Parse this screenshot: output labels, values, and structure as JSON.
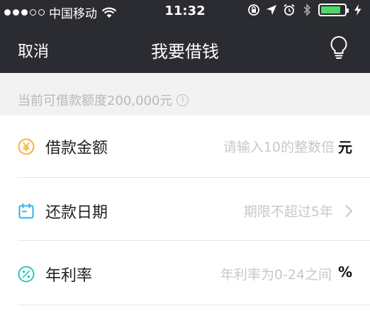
{
  "status_bar": {
    "carrier": "中国移动",
    "time": "11:32",
    "battery_level": 0.85
  },
  "nav": {
    "cancel_label": "取消",
    "title": "我要借钱",
    "right_icon": "lightbulb-icon"
  },
  "quota": {
    "text": "当前可借款额度200,000元",
    "icon": "info-icon",
    "icon_glyph": "i"
  },
  "form": {
    "rows": [
      {
        "icon": "yuan-coin-icon",
        "label": "借款金额",
        "placeholder": "请输入10的整数倍",
        "unit": "元"
      },
      {
        "icon": "calendar-icon",
        "label": "还款日期",
        "placeholder": "期限不超过5年",
        "trailing": "chevron-right-icon"
      },
      {
        "icon": "percent-icon",
        "label": "年利率",
        "placeholder": "年利率为0-24之间",
        "unit": "%"
      }
    ]
  },
  "colors": {
    "header_bg": "#2b2c31",
    "page_bg": "#f2f2f2",
    "amount_icon": "#f5b33c",
    "date_icon": "#2bb6e8",
    "rate_icon": "#2ec4c4",
    "battery": "#4cd964"
  }
}
